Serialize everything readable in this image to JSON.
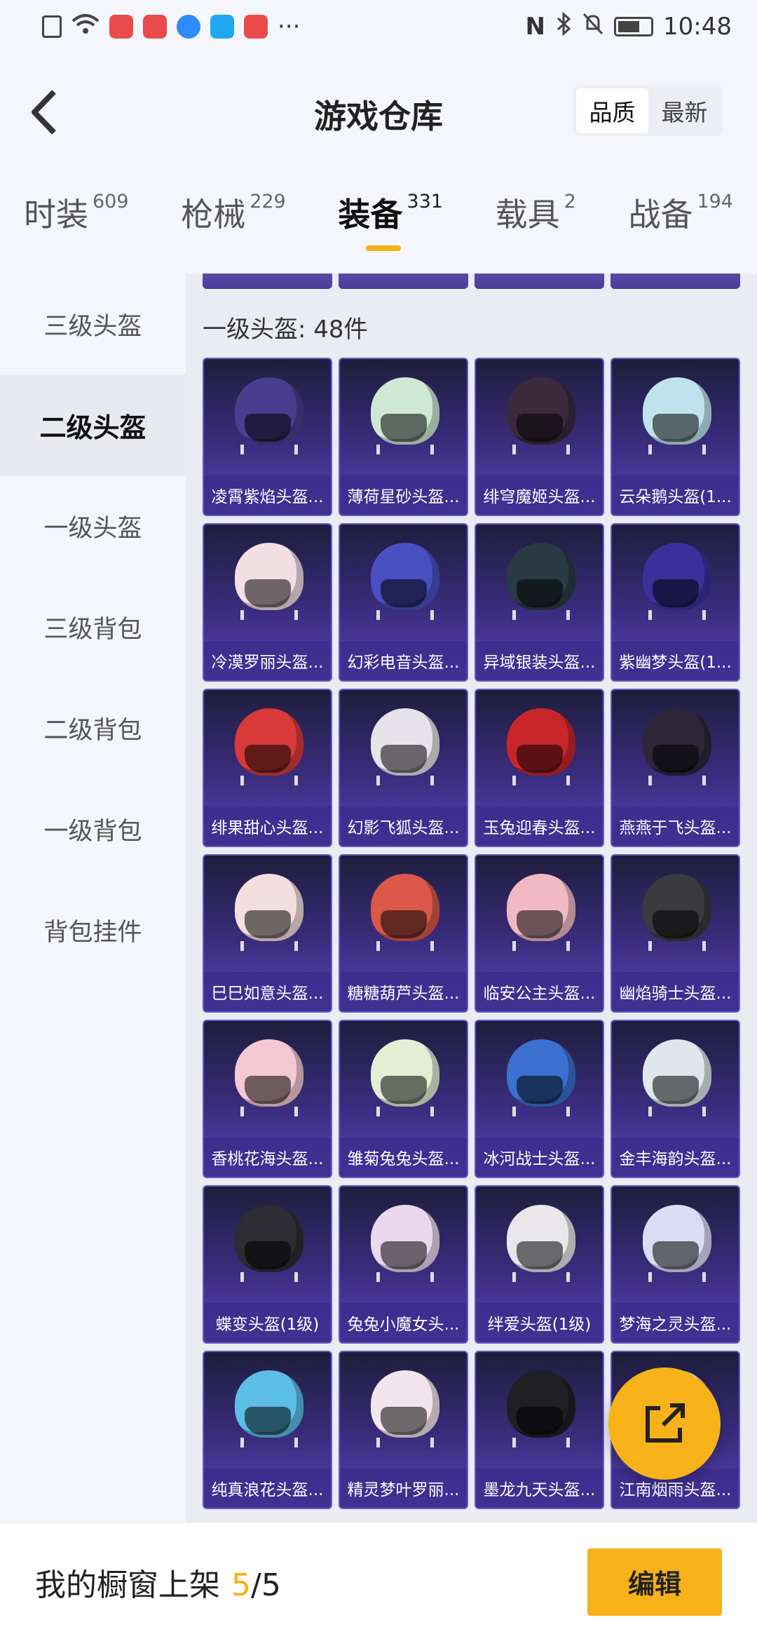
{
  "status_bar": {
    "time": "10:48",
    "more": "···",
    "nfc": "N"
  },
  "header": {
    "title": "游戏仓库",
    "sort_options": [
      "品质",
      "最新"
    ],
    "sort_selected": "品质"
  },
  "tabs": [
    {
      "label": "时装",
      "count": "609"
    },
    {
      "label": "枪械",
      "count": "229"
    },
    {
      "label": "装备",
      "count": "331",
      "active": true
    },
    {
      "label": "载具",
      "count": "2"
    },
    {
      "label": "战备",
      "count": "194"
    }
  ],
  "sidebar": {
    "items": [
      "三级头盔",
      "二级头盔",
      "一级头盔",
      "三级背包",
      "二级背包",
      "一级背包",
      "背包挂件"
    ],
    "active": "二级头盔"
  },
  "section": {
    "title": "一级头盔: 48件"
  },
  "items": [
    {
      "name": "凌霄紫焰头盔...",
      "color": "#4a3d8f"
    },
    {
      "name": "薄荷星砂头盔...",
      "color": "#cfe8d4"
    },
    {
      "name": "绯穹魔姬头盔...",
      "color": "#3a2a3c"
    },
    {
      "name": "云朵鹅头盔(1...",
      "color": "#bfe3ec"
    },
    {
      "name": "冷漠罗丽头盔...",
      "color": "#f1dfe4"
    },
    {
      "name": "幻彩电音头盔...",
      "color": "#4a4fc2"
    },
    {
      "name": "异域银装头盔...",
      "color": "#2a3a44"
    },
    {
      "name": "紫幽梦头盔(1...",
      "color": "#3c2f9c"
    },
    {
      "name": "绯果甜心头盔...",
      "color": "#d83a3a"
    },
    {
      "name": "幻影飞狐头盔...",
      "color": "#e7e3ea"
    },
    {
      "name": "玉兔迎春头盔...",
      "color": "#c9262a"
    },
    {
      "name": "燕燕于飞头盔...",
      "color": "#2c2638"
    },
    {
      "name": "巳巳如意头盔...",
      "color": "#f4dfe0"
    },
    {
      "name": "糖糖葫芦头盔...",
      "color": "#d9584a"
    },
    {
      "name": "临安公主头盔...",
      "color": "#f1b9c4"
    },
    {
      "name": "幽焰骑士头盔...",
      "color": "#3a3a3e"
    },
    {
      "name": "香桃花海头盔...",
      "color": "#f5c9d3"
    },
    {
      "name": "雏菊兔兔头盔...",
      "color": "#e5edd4"
    },
    {
      "name": "冰河战士头盔...",
      "color": "#3b6fd0"
    },
    {
      "name": "金丰海韵头盔...",
      "color": "#dfe6ec"
    },
    {
      "name": "蝶变头盔(1级)",
      "color": "#2c2c32"
    },
    {
      "name": "兔兔小魔女头...",
      "color": "#e9d8ee"
    },
    {
      "name": "绊爱头盔(1级)",
      "color": "#e9e7ea"
    },
    {
      "name": "梦海之灵头盔...",
      "color": "#dcdcf4"
    },
    {
      "name": "纯真浪花头盔...",
      "color": "#5cbde6"
    },
    {
      "name": "精灵梦叶罗丽...",
      "color": "#f2e6ec"
    },
    {
      "name": "墨龙九天头盔...",
      "color": "#1f1f24"
    },
    {
      "name": "江南烟雨头盔...",
      "color": "#c8d9ea"
    }
  ],
  "bottom_bar": {
    "label": "我的橱窗上架",
    "current": "5",
    "separator": "/",
    "max": "5",
    "edit_label": "编辑"
  }
}
